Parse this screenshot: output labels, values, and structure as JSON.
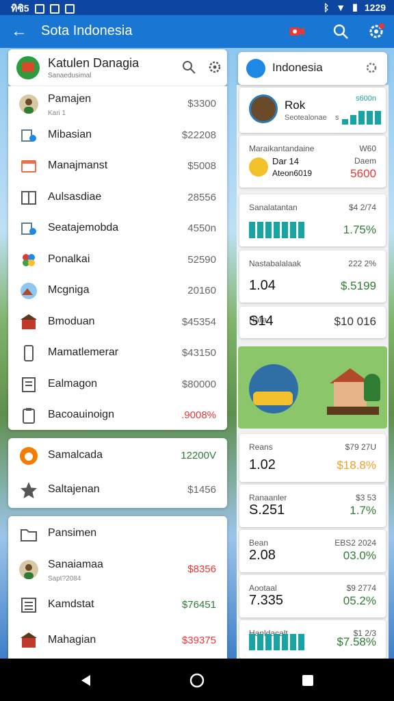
{
  "status": {
    "left": "ทิซิ5",
    "right": "1229"
  },
  "appbar": {
    "title": "Sota Indonesia"
  },
  "left_header": {
    "title": "Katulen Danagia",
    "subtitle": "Sanaedusimal"
  },
  "list": [
    {
      "label": "Pamajen",
      "sub": "Kari 1",
      "amount": "$3300",
      "tone": "gray",
      "icon": "avatar-icon"
    },
    {
      "label": "Mibasian",
      "sub": "",
      "amount": "$22208",
      "tone": "gray",
      "icon": "people-icon"
    },
    {
      "label": "Manajmanst",
      "sub": "",
      "amount": "$5008",
      "tone": "gray",
      "icon": "calendar-icon"
    },
    {
      "label": "Aulsasdiae",
      "sub": "",
      "amount": "28556",
      "tone": "gray",
      "icon": "book-icon"
    },
    {
      "label": "Seatajemobda",
      "sub": "",
      "amount": "4550n",
      "tone": "gray",
      "icon": "people-icon"
    },
    {
      "label": "Ponalkai",
      "sub": "",
      "amount": "52590",
      "tone": "gray",
      "icon": "photos-icon"
    },
    {
      "label": "Mcgniga",
      "sub": "",
      "amount": "20160",
      "tone": "gray",
      "icon": "landscape-icon"
    },
    {
      "label": "Bmoduan",
      "sub": "",
      "amount": "$45354",
      "tone": "gray",
      "icon": "building-icon"
    },
    {
      "label": "Mamatlemerar",
      "sub": "",
      "amount": "$43150",
      "tone": "gray",
      "icon": "phone-icon"
    },
    {
      "label": "Ealmagon",
      "sub": "",
      "amount": "$80000",
      "tone": "gray",
      "icon": "document-icon"
    },
    {
      "label": "Bacoauinoign",
      "sub": "",
      "amount": ".9008%",
      "tone": "red",
      "icon": "clipboard-icon"
    }
  ],
  "mid": [
    {
      "label": "Samalcada",
      "amount": "12200V",
      "tone": "green",
      "icon": "circle-orange-icon"
    },
    {
      "label": "Saltajenan",
      "amount": "$1456",
      "tone": "gray",
      "icon": "star-icon"
    }
  ],
  "bottom": [
    {
      "label": "Pansimen",
      "sub": "",
      "amount": "",
      "tone": "gray",
      "icon": "folder-icon"
    },
    {
      "label": "Sanaiamaa",
      "sub": "Sapt?2084",
      "amount": "$8356",
      "tone": "red",
      "icon": "avatar-icon"
    },
    {
      "label": "Kamdstat",
      "sub": "",
      "amount": "$76451",
      "tone": "green",
      "icon": "list-icon"
    },
    {
      "label": "Mahagian",
      "sub": "",
      "amount": "$39375",
      "tone": "red",
      "icon": "building-icon"
    }
  ],
  "right_header": {
    "title": "Indonesia"
  },
  "right_profile": {
    "name": "Rok",
    "sub": "Seotealonae",
    "value": "s600n",
    "prefix": "s"
  },
  "rcards": [
    {
      "k": "Maraikantandaine",
      "kr": "W60",
      "line1": "Dar 14",
      "line2": "Ateon6019",
      "big": "",
      "pct": "5600",
      "pct_label": "Daem",
      "color": "#e53935"
    },
    {
      "k": "Sanalatantan",
      "kr": "$4 2/74",
      "big": "",
      "pct": "1.75%",
      "color": "#2e7d32"
    },
    {
      "k": "Nastabalalaak",
      "kr": "222 2%",
      "big": "1.04",
      "pct": "$.5199",
      "color": "#2e7d32"
    },
    {
      "k": "Rara",
      "kr": "",
      "big": "S14",
      "pct": "$10 016",
      "color": "#333"
    }
  ],
  "rcards2": [
    {
      "k": "Reans",
      "kr": "$79 27U",
      "big": "1.02",
      "pct": "$18.8%",
      "color": "#f0a024"
    },
    {
      "k": "Ranaanler",
      "kr": "$3 53",
      "big": "S.251",
      "pct": "1.7%",
      "color": "#2e7d32"
    },
    {
      "k": "Bean",
      "kr": "EBS2 2024",
      "big": "2.08",
      "pct": "03.0%",
      "color": "#2e7d32"
    },
    {
      "k": "Aootaal",
      "kr": "$9 2774",
      "big": "7.335",
      "pct": "05.2%",
      "color": "#2e7d32"
    },
    {
      "k": "Hanldacalt",
      "kr": "$1 2/3",
      "big": "",
      "pct": "$7.58%",
      "color": "#2e7d32"
    }
  ]
}
